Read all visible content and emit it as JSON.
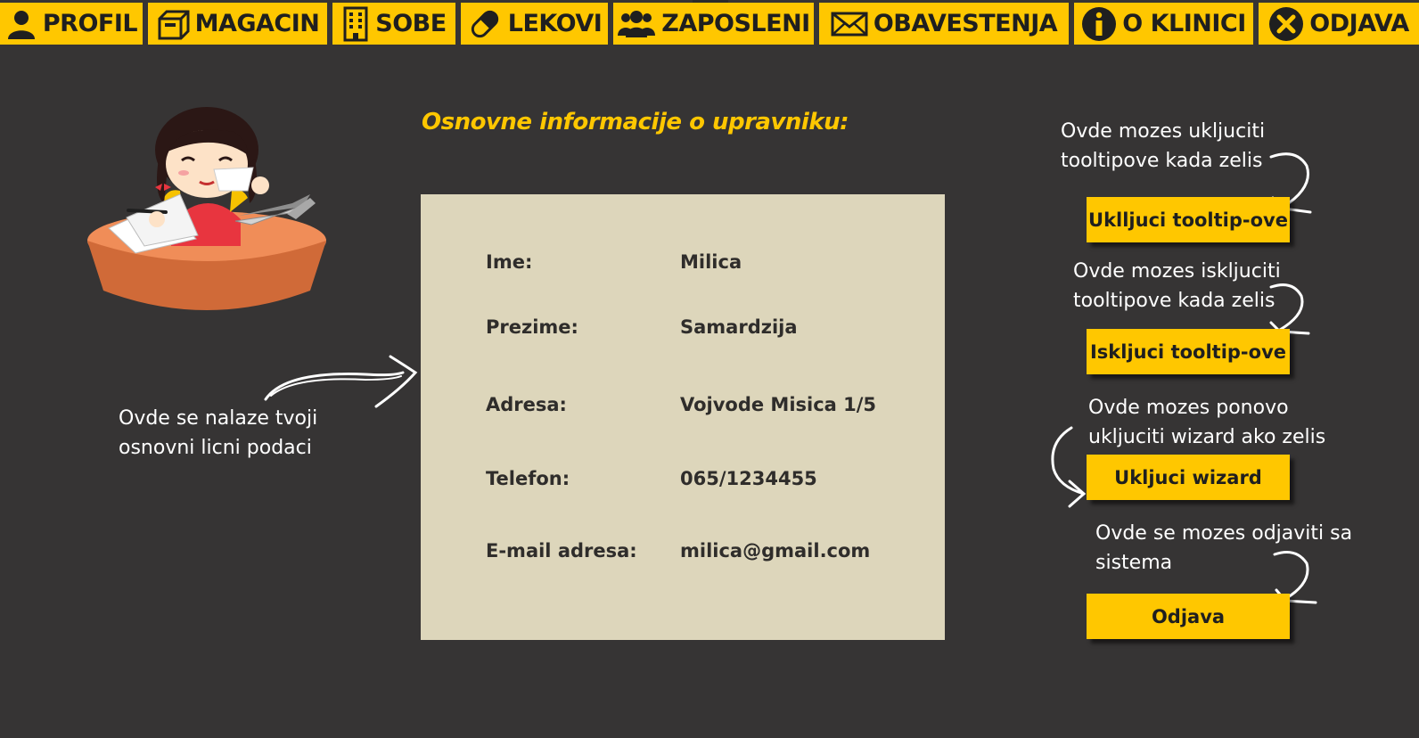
{
  "nav": {
    "items": [
      {
        "label": "PROFIL",
        "icon": "user-icon"
      },
      {
        "label": "MAGACIN",
        "icon": "box-icon"
      },
      {
        "label": "SOBE",
        "icon": "building-icon"
      },
      {
        "label": "LEKOVI",
        "icon": "pill-icon"
      },
      {
        "label": "ZAPOSLENI",
        "icon": "users-icon"
      },
      {
        "label": "OBAVESTENJA",
        "icon": "envelope-icon"
      },
      {
        "label": "O KLINICI",
        "icon": "info-icon"
      },
      {
        "label": "ODJAVA",
        "icon": "close-circle-icon"
      }
    ]
  },
  "left_note": {
    "line1": "Ovde se nalaze tvoji",
    "line2": "osnovni licni podaci"
  },
  "card": {
    "title": "Osnovne informacije o upravniku:",
    "rows": [
      {
        "label": "Ime:",
        "value": "Milica"
      },
      {
        "label": "Prezime:",
        "value": "Samardzija"
      },
      {
        "label": "Adresa:",
        "value": "Vojvode Misica 1/5"
      },
      {
        "label": "Telefon:",
        "value": "065/1234455"
      },
      {
        "label": "E-mail adresa:",
        "value": "milica@gmail.com"
      }
    ]
  },
  "actions": [
    {
      "hint_line1": "Ovde mozes ukljuciti",
      "hint_line2": "tooltipove kada zelis",
      "button": "Uklljuci tooltip-ove"
    },
    {
      "hint_line1": "Ovde mozes iskljuciti",
      "hint_line2": "tooltipove kada zelis",
      "button": "Iskljuci tooltip-ove"
    },
    {
      "hint_line1": "Ovde mozes ponovo",
      "hint_line2": "ukljuciti wizard ako zelis",
      "button": "Ukljuci wizard"
    },
    {
      "hint_line1": "Ovde se mozes odjaviti sa",
      "hint_line2": "sistema",
      "button": "Odjava"
    }
  ],
  "colors": {
    "accent": "#ffc700",
    "background": "#363434",
    "card": "#ddd6bb"
  }
}
